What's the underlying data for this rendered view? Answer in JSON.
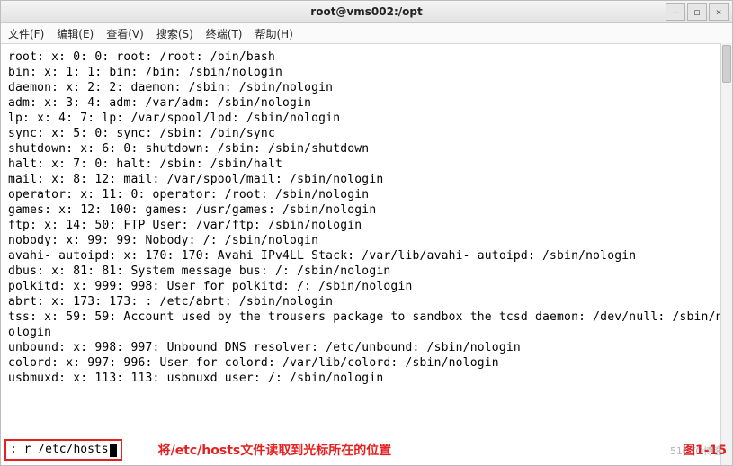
{
  "window": {
    "title": "root@vms002:/opt",
    "buttons": {
      "min": "–",
      "max": "◻",
      "close": "×"
    }
  },
  "menu": {
    "file": "文件(F)",
    "edit": "编辑(E)",
    "view": "查看(V)",
    "search": "搜索(S)",
    "terminal": "终端(T)",
    "help": "帮助(H)"
  },
  "lines": [
    "root: x: 0: 0: root: /root: /bin/bash",
    "bin: x: 1: 1: bin: /bin: /sbin/nologin",
    "daemon: x: 2: 2: daemon: /sbin: /sbin/nologin",
    "adm: x: 3: 4: adm: /var/adm: /sbin/nologin",
    "lp: x: 4: 7: lp: /var/spool/lpd: /sbin/nologin",
    "sync: x: 5: 0: sync: /sbin: /bin/sync",
    "shutdown: x: 6: 0: shutdown: /sbin: /sbin/shutdown",
    "halt: x: 7: 0: halt: /sbin: /sbin/halt",
    "mail: x: 8: 12: mail: /var/spool/mail: /sbin/nologin",
    "operator: x: 11: 0: operator: /root: /sbin/nologin",
    "games: x: 12: 100: games: /usr/games: /sbin/nologin",
    "ftp: x: 14: 50: FTP User: /var/ftp: /sbin/nologin",
    "nobody: x: 99: 99: Nobody: /: /sbin/nologin",
    "avahi- autoipd: x: 170: 170: Avahi IPv4LL Stack: /var/lib/avahi- autoipd: /sbin/nologin",
    "dbus: x: 81: 81: System message bus: /: /sbin/nologin",
    "polkitd: x: 999: 998: User for polkitd: /: /sbin/nologin",
    "abrt: x: 173: 173: : /etc/abrt: /sbin/nologin",
    "tss: x: 59: 59: Account used by the trousers package to sandbox the tcsd daemon: /dev/null: /sbin/nologin",
    "unbound: x: 998: 997: Unbound DNS resolver: /etc/unbound: /sbin/nologin",
    "colord: x: 997: 996: User for colord: /var/lib/colord: /sbin/nologin",
    "usbmuxd: x: 113: 113: usbmuxd user: /: /sbin/nologin"
  ],
  "command": {
    "text": ": r /etc/hosts"
  },
  "annotation": {
    "text": "将/etc/hosts文件读取到光标所在的位置",
    "fig": "图1-15"
  },
  "watermark": "51CTO博客"
}
